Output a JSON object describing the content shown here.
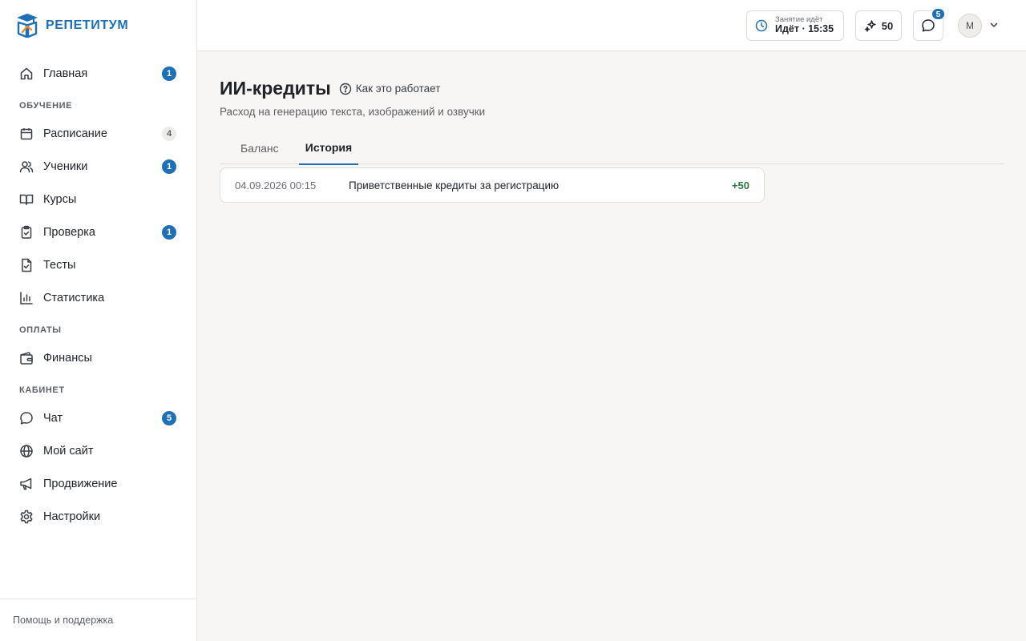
{
  "brand": {
    "name": "РЕПЕТИТУМ"
  },
  "sidebar": {
    "items": [
      {
        "label": "Главная",
        "badge": "1"
      },
      {
        "label": "Расписание",
        "badge": "4"
      },
      {
        "label": "Ученики",
        "badge": "1"
      },
      {
        "label": "Курсы"
      },
      {
        "label": "Проверка",
        "badge": "1"
      },
      {
        "label": "Тесты"
      },
      {
        "label": "Статистика"
      },
      {
        "label": "Финансы"
      },
      {
        "label": "Чат",
        "badge": "5"
      },
      {
        "label": "Мой сайт"
      },
      {
        "label": "Продвижение"
      },
      {
        "label": "Настройки"
      }
    ],
    "sections": {
      "learning": "ОБУЧЕНИЕ",
      "payments": "ОПЛАТЫ",
      "cabinet": "КАБИНЕТ"
    },
    "footer": "Помощь и поддержка"
  },
  "topbar": {
    "lesson_sub": "Занятие идёт",
    "lesson_main": "Идёт · 15:35",
    "credits": "50",
    "chat_badge": "5",
    "avatar_initial": "М"
  },
  "page": {
    "title": "ИИ-кредиты",
    "how_it_works": "Как это работает",
    "subtitle": "Расход на генерацию текста, изображений и озвучки",
    "tabs": [
      {
        "label": "Баланс"
      },
      {
        "label": "История"
      }
    ],
    "active_tab": "История"
  },
  "history": [
    {
      "date": "04.09.2026 00:15",
      "description": "Приветственные кредиты за регистрацию",
      "amount": "+50"
    }
  ],
  "colors": {
    "accent": "#1d6fb8",
    "positive": "#2b7a45",
    "background": "#f7f6f4"
  }
}
